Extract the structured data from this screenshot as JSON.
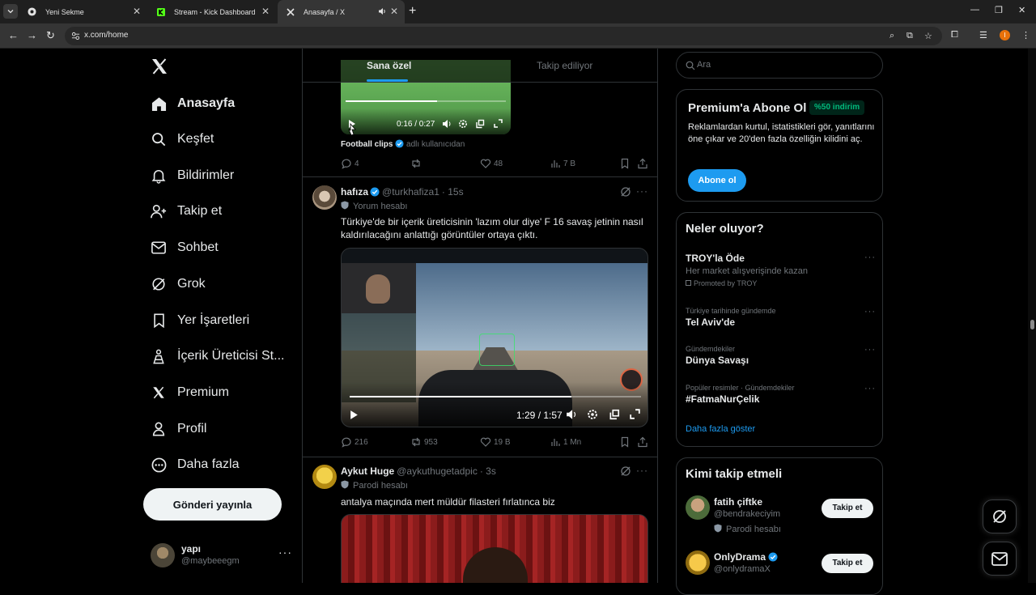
{
  "browser": {
    "tabs": [
      {
        "title": "Yeni Sekme",
        "icon": "chrome-icon"
      },
      {
        "title": "Stream - Kick Dashboard",
        "icon": "kick-icon"
      },
      {
        "title": "Anasayfa / X",
        "icon": "x-icon"
      }
    ],
    "active_tab": 2,
    "url": "x.com/home",
    "profile_initial": "I"
  },
  "nav": {
    "items": [
      {
        "label": "Anasayfa",
        "icon": "home-icon"
      },
      {
        "label": "Keşfet",
        "icon": "search-icon"
      },
      {
        "label": "Bildirimler",
        "icon": "bell-icon"
      },
      {
        "label": "Takip et",
        "icon": "follow-icon"
      },
      {
        "label": "Sohbet",
        "icon": "mail-icon"
      },
      {
        "label": "Grok",
        "icon": "grok-icon"
      },
      {
        "label": "Yer İşaretleri",
        "icon": "bookmark-icon"
      },
      {
        "label": "İçerik Üreticisi St...",
        "icon": "creator-icon"
      },
      {
        "label": "Premium",
        "icon": "x-icon"
      },
      {
        "label": "Profil",
        "icon": "person-icon"
      },
      {
        "label": "Daha fazla",
        "icon": "more-circle-icon"
      }
    ],
    "post_button": "Gönderi yayınla",
    "account": {
      "name": "yapı",
      "handle": "@maybeeegm"
    }
  },
  "feed": {
    "tabs": [
      "Sana özel",
      "Takip ediliyor"
    ],
    "active_tab": 0,
    "post0": {
      "video_time": "0:16 / 0:27",
      "progress": 0.57,
      "credit_name": "Football clips",
      "credit_suffix": "adlı kullanıcıdan",
      "replies": "4",
      "reposts": "",
      "likes": "48",
      "views": "7 B"
    },
    "post1": {
      "name": "hafıza",
      "handle": "@turkhafiza1",
      "time": "· 15s",
      "label": "Yorum hesabı",
      "text": "Türkiye'de bir içerik üreticisinin 'lazım olur diye' F 16 savaş jetinin nasıl kaldırılacağını anlattığı görüntüler ortaya çıktı.",
      "video_time": "1:29 / 1:57",
      "progress": 0.76,
      "replies": "216",
      "reposts": "953",
      "likes": "19 B",
      "views": "1 Mn"
    },
    "post2": {
      "name": "Aykut Huge",
      "handle": "@aykuthugetadpic",
      "time": "· 3s",
      "label": "Parodi hesabı",
      "text": "antalya maçında mert müldür filasteri fırlatınca biz"
    }
  },
  "right": {
    "search_placeholder": "Ara",
    "premium": {
      "title": "Premium'a Abone Ol",
      "badge": "%50 indirim",
      "desc": "Reklamlardan kurtul, istatistikleri gör, yanıtlarını öne çıkar ve 20'den fazla özelliğin kilidini aç.",
      "button": "Abone ol"
    },
    "trends": {
      "title": "Neler oluyor?",
      "items": [
        {
          "topic": "TROY'la Öde",
          "desc": "Her market alışverişinde kazan",
          "promoted": "Promoted by TROY"
        },
        {
          "context": "Türkiye tarihinde gündemde",
          "topic": "Tel Aviv'de"
        },
        {
          "context": "Gündemdekiler",
          "topic": "Dünya Savaşı"
        },
        {
          "context": "Popüler resimler · Gündemdekiler",
          "topic": "#FatmaNurÇelik"
        }
      ],
      "show_more": "Daha fazla göster"
    },
    "who_to_follow": {
      "title": "Kimi takip etmeli",
      "users": [
        {
          "name": "fatih çiftke",
          "handle": "@bendrakeciyim",
          "label": "Parodi hesabı",
          "button": "Takip et"
        },
        {
          "name": "OnlyDrama",
          "handle": "@onlydramaX",
          "button": "Takip et"
        }
      ]
    }
  },
  "colors": {
    "accent": "#1d9bf0",
    "green": "#00ba7c",
    "border": "#2f3336",
    "muted": "#71767b"
  }
}
